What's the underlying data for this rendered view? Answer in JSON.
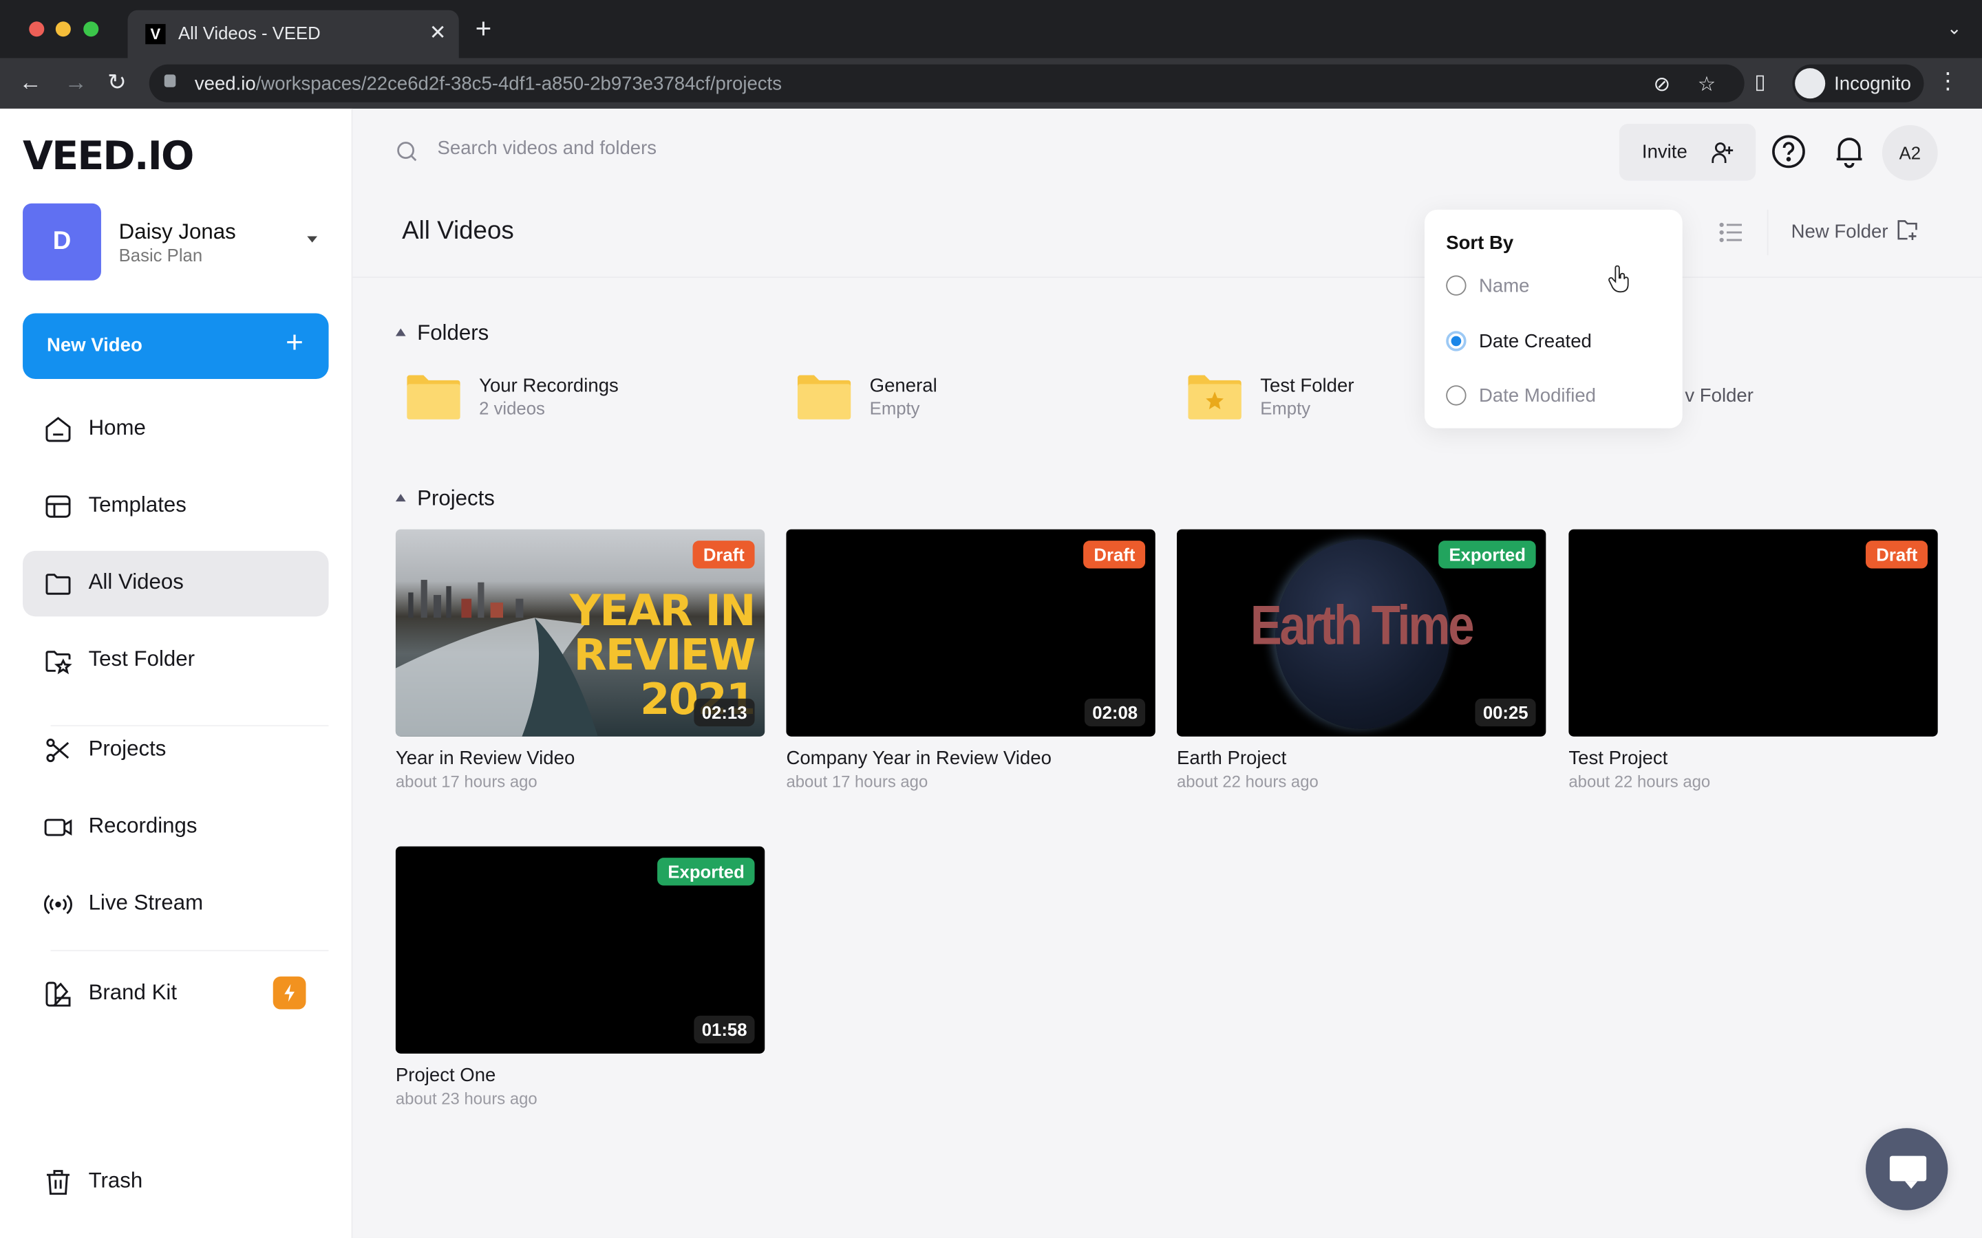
{
  "browser": {
    "tab_title": "All Videos - VEED",
    "tab_favicon": "V",
    "url_domain": "veed.io",
    "url_path": "/workspaces/22ce6d2f-38c5-4df1-a850-2b973e3784cf/projects",
    "profile_label": "Incognito",
    "traffic_colors": [
      "#ed5f57",
      "#f4bd3a",
      "#3bc64a"
    ]
  },
  "sidebar": {
    "logo": "VEED.IO",
    "account": {
      "initial": "D",
      "name": "Daisy Jonas",
      "plan": "Basic Plan"
    },
    "new_video_label": "New Video",
    "items": [
      {
        "label": "Home",
        "icon": "home-icon"
      },
      {
        "label": "Templates",
        "icon": "templates-icon"
      },
      {
        "label": "All Videos",
        "icon": "folder-icon",
        "active": true
      },
      {
        "label": "Test Folder",
        "icon": "folder-star-icon"
      },
      {
        "label": "Projects",
        "icon": "scissors-icon"
      },
      {
        "label": "Recordings",
        "icon": "video-camera-icon"
      },
      {
        "label": "Live Stream",
        "icon": "broadcast-icon"
      },
      {
        "label": "Brand Kit",
        "icon": "brand-kit-icon",
        "badge": "lightning-icon"
      },
      {
        "label": "Trash",
        "icon": "trash-icon"
      }
    ]
  },
  "header": {
    "search_placeholder": "Search videos and folders",
    "invite_label": "Invite",
    "user_initials": "A2"
  },
  "page": {
    "title": "All Videos",
    "new_folder_label": "New Folder"
  },
  "sort_menu": {
    "title": "Sort By",
    "options": [
      {
        "label": "Name",
        "selected": false
      },
      {
        "label": "Date Created",
        "selected": true
      },
      {
        "label": "Date Modified",
        "selected": false
      }
    ]
  },
  "folders": {
    "header": "Folders",
    "items": [
      {
        "name": "Your Recordings",
        "count": "2 videos"
      },
      {
        "name": "General",
        "count": "Empty"
      },
      {
        "name": "Test Folder",
        "count": "Empty",
        "starred": true
      },
      {
        "name": "New Folder",
        "partial_label": "v Folder"
      }
    ]
  },
  "projects": {
    "header": "Projects",
    "items": [
      {
        "name": "Year in Review Video",
        "date": "about 17 hours ago",
        "status": "Draft",
        "duration": "02:13",
        "thumb_text": [
          "YEAR IN",
          "REVIEW",
          "2021"
        ]
      },
      {
        "name": "Company Year in Review Video",
        "date": "about 17 hours ago",
        "status": "Draft",
        "duration": "02:08"
      },
      {
        "name": "Earth Project",
        "date": "about 22 hours ago",
        "status": "Exported",
        "duration": "00:25",
        "thumb_text": [
          "Earth Time"
        ]
      },
      {
        "name": "Test Project",
        "date": "about 22 hours ago",
        "status": "Draft",
        "duration": ""
      },
      {
        "name": "Project One",
        "date": "about 23 hours ago",
        "status": "Exported",
        "duration": "01:58"
      }
    ]
  },
  "colors": {
    "accent": "#1390f0",
    "draft": "#ec5c2c",
    "exported": "#22a45e",
    "avatar": "#6070f2",
    "brand_badge": "#f2921f"
  }
}
